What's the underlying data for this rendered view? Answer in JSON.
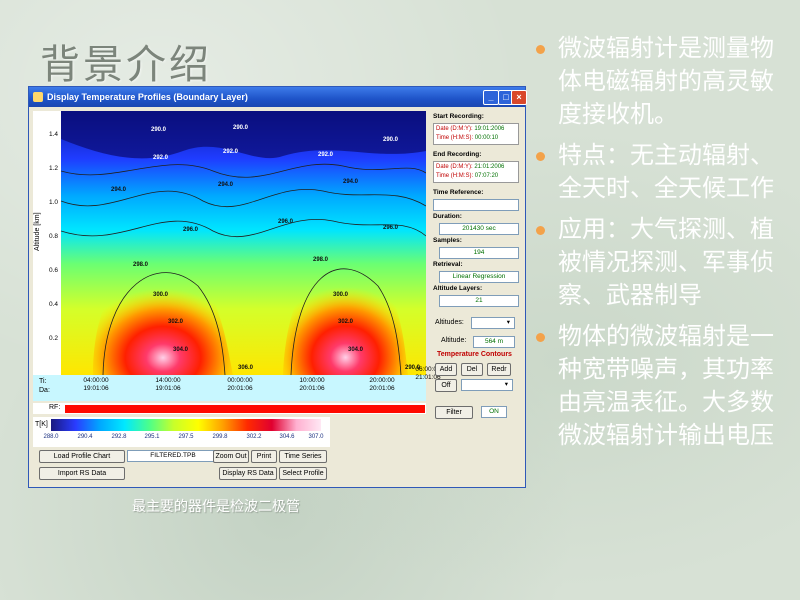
{
  "slide": {
    "title": "背景介绍",
    "caption": "最主要的器件是检波二极管",
    "bullets": [
      "微波辐射计是测量物体电磁辐射的高灵敏度接收机。",
      "特点：无主动辐射、全天时、全天候工作",
      "应用：大气探测、植被情况探测、军事侦察、武器制导",
      "物体的微波辐射是一种宽带噪声，其功率由亮温表征。大多数微波辐射计输出电压"
    ]
  },
  "window": {
    "title": "Display Temperature Profiles (Boundary Layer)",
    "buttons": {
      "minimize": "_",
      "maximize": "□",
      "close": "×"
    }
  },
  "plot": {
    "ylabel": "Altitude [km]",
    "yticks": [
      "1.4",
      "1.2",
      "1.0",
      "0.8",
      "0.6",
      "0.4",
      "0.2"
    ],
    "contour_labels": [
      "290.0",
      "290.0",
      "290.0",
      "292.0",
      "292.0",
      "292.0",
      "294.0",
      "294.0",
      "294.0",
      "296.0",
      "296.0",
      "296.0",
      "298.0",
      "298.0",
      "300.0",
      "300.0",
      "302.0",
      "302.0",
      "304.0",
      "304.0",
      "306.0",
      "290.0"
    ],
    "row_labels": {
      "time": "Ti:",
      "date": "Da:"
    },
    "time_ticks": [
      {
        "time": "04:00:00",
        "date": "19:01:06"
      },
      {
        "time": "14:00:00",
        "date": "19:01:06"
      },
      {
        "time": "00:00:00",
        "date": "20:01:06"
      },
      {
        "time": "10:00:00",
        "date": "20:01:06"
      },
      {
        "time": "20:00:00",
        "date": "20:01:06"
      },
      {
        "time": "06:00:00",
        "date": "21:01:06"
      }
    ],
    "rf_label": "RF:",
    "colorbar_unit": "T[K]",
    "colorbar_ticks": [
      "288.0",
      "290.4",
      "292.8",
      "295.1",
      "297.5",
      "299.8",
      "302.2",
      "304.6",
      "307.0"
    ]
  },
  "controls": {
    "load_profile_chart": "Load Profile Chart",
    "file_name": "FILTERED.TPB",
    "zoom_out": "Zoom Out",
    "print": "Print",
    "time_series": "Time Series",
    "import_rs": "Import RS Data",
    "display_rs": "Display RS Data",
    "select_profile": "Select Profile"
  },
  "side_panel": {
    "start_recording": {
      "label": "Start Recording:",
      "date_label": "Date (D:M:Y):",
      "date": "19:01:2006",
      "time_label": "Time (H:M:S):",
      "time": "00:00:10"
    },
    "end_recording": {
      "label": "End Recording:",
      "date_label": "Date (D:M:Y):",
      "date": "21:01:2006",
      "time_label": "Time (H:M:S):",
      "time": "07:07:20"
    },
    "time_reference_label": "Time Reference:",
    "duration_label": "Duration:",
    "duration": "201430 sec",
    "samples_label": "Samples:",
    "samples": "194",
    "retrieval_label": "Retrieval:",
    "retrieval": "Linear Regression",
    "altitude_layers_label": "Altitude Layers:",
    "altitude_layers": "21",
    "altitudes_label": "Altitudes:",
    "altitude_label": "Altitude:",
    "altitude": "564 m",
    "temperature_contours_label": "Temperature Contours",
    "add": "Add",
    "del": "Del",
    "redo": "Redr",
    "off": "Off",
    "filter": "Filter",
    "filter_state": "ON"
  }
}
